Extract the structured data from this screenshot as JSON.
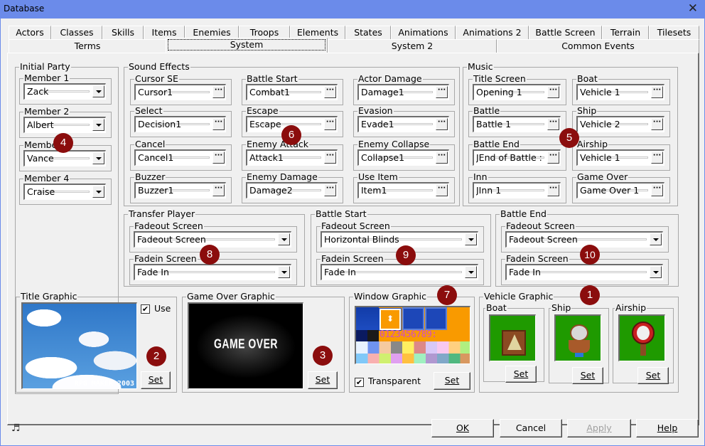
{
  "window": {
    "title": "Database",
    "close_label": "✕"
  },
  "tabs_row1": [
    {
      "label": "Actors"
    },
    {
      "label": "Classes"
    },
    {
      "label": "Skills"
    },
    {
      "label": "Items"
    },
    {
      "label": "Enemies"
    },
    {
      "label": "Troops"
    },
    {
      "label": "Elements"
    },
    {
      "label": "States"
    },
    {
      "label": "Animations"
    },
    {
      "label": "Animations 2"
    },
    {
      "label": "Battle Screen"
    },
    {
      "label": "Terrain"
    },
    {
      "label": "Tilesets"
    }
  ],
  "tabs_row2": [
    {
      "label": "Terms"
    },
    {
      "label": "System",
      "selected": true
    },
    {
      "label": "System 2"
    },
    {
      "label": "Common Events"
    }
  ],
  "initial_party": {
    "title": "Initial Party",
    "members": [
      {
        "label": "Member 1",
        "value": "Zack"
      },
      {
        "label": "Member 2",
        "value": "Albert"
      },
      {
        "label": "Member 3",
        "value": "Vance"
      },
      {
        "label": "Member 4",
        "value": "Craise"
      }
    ]
  },
  "sound_effects": {
    "title": "Sound Effects",
    "items": [
      {
        "label": "Cursor SE",
        "value": "Cursor1"
      },
      {
        "label": "Select",
        "value": "Decision1"
      },
      {
        "label": "Cancel",
        "value": "Cancel1"
      },
      {
        "label": "Buzzer",
        "value": "Buzzer1"
      },
      {
        "label": "Battle Start",
        "value": "Combat1"
      },
      {
        "label": "Escape",
        "value": "Escape"
      },
      {
        "label": "Enemy Attack",
        "value": "Attack1"
      },
      {
        "label": "Enemy Damage",
        "value": "Damage2"
      },
      {
        "label": "Actor Damage",
        "value": "Damage1"
      },
      {
        "label": "Evasion",
        "value": "Evade1"
      },
      {
        "label": "Enemy Collapse",
        "value": "Collapse1"
      },
      {
        "label": "Use Item",
        "value": "Item1"
      }
    ],
    "browse_label": "···"
  },
  "music": {
    "title": "Music",
    "items": [
      {
        "label": "Title Screen",
        "value": "Opening 1"
      },
      {
        "label": "Battle",
        "value": "Battle 1"
      },
      {
        "label": "Battle End",
        "value": "JEnd of Battle :"
      },
      {
        "label": "Inn",
        "value": "JInn 1"
      },
      {
        "label": "Boat",
        "value": "Vehicle 1"
      },
      {
        "label": "Ship",
        "value": "Vehicle 2"
      },
      {
        "label": "Airship",
        "value": "Vehicle 1"
      },
      {
        "label": "Game Over",
        "value": "Game Over 1"
      }
    ]
  },
  "transfer_player": {
    "title": "Transfer Player",
    "fadeout_label": "Fadeout Screen",
    "fadeout_value": "Fadeout Screen",
    "fadein_label": "Fadein Screen",
    "fadein_value": "Fade In"
  },
  "battle_start": {
    "title": "Battle Start",
    "fadeout_label": "Fadeout Screen",
    "fadeout_value": "Horizontal Blinds",
    "fadein_label": "Fadein Screen",
    "fadein_value": "Fade In"
  },
  "battle_end": {
    "title": "Battle End",
    "fadeout_label": "Fadeout Screen",
    "fadeout_value": "Fadeout Screen",
    "fadein_label": "Fadein Screen",
    "fadein_value": "Fade In"
  },
  "title_graphic": {
    "title": "Title Graphic",
    "use_label": "Use",
    "use_checked": true,
    "set_label": "Set",
    "watermark": "RPG MAKER 2003"
  },
  "game_over_graphic": {
    "title": "Game Over Graphic",
    "image_text": "GAME OVER",
    "set_label": "Set"
  },
  "window_graphic": {
    "title": "Window Graphic",
    "transparent_label": "Transparent",
    "transparent_checked": true,
    "set_label": "Set",
    "digits": "0123456789:"
  },
  "vehicle_graphic": {
    "title": "Vehicle Graphic",
    "vehicles": [
      {
        "label": "Boat",
        "set_label": "Set"
      },
      {
        "label": "Ship",
        "set_label": "Set"
      },
      {
        "label": "Airship",
        "set_label": "Set"
      }
    ]
  },
  "badges": [
    "1",
    "2",
    "3",
    "4",
    "5",
    "6",
    "7",
    "8",
    "9",
    "10"
  ],
  "footer": {
    "ok_label": "OK",
    "cancel_label": "Cancel",
    "apply_label": "Apply",
    "help_label": "Help",
    "music_icon": "♬"
  },
  "colors": {
    "badge": "#8b0d0d",
    "titlebar": "#6b8bea",
    "window_bg": "#f0f0f0"
  }
}
